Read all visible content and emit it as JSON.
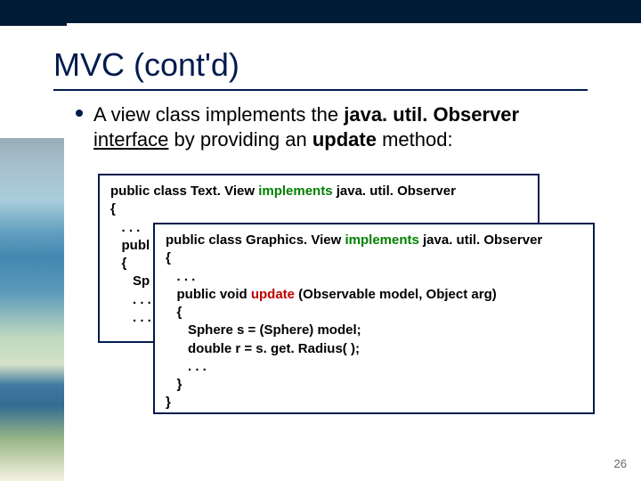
{
  "title": "MVC (cont'd)",
  "body": {
    "pre": "A view class implements the ",
    "kw1": "java. util. Observer",
    "mid_ul": "interface",
    "mid": " by providing an ",
    "kw2": "update",
    "post": " method:"
  },
  "codeA": {
    "l1a": "public class Text. View ",
    "l1b": "implements",
    "l1c": " java. util. Observer",
    "l2": "{",
    "l3": "   . . .",
    "l4": "   publ",
    "l5": "   {",
    "l6": "      Sp",
    "l7": "      . . .",
    "l8": "      . . ."
  },
  "codeB": {
    "l1a": "public class Graphics. View ",
    "l1b": "implements",
    "l1c": " java. util. Observer",
    "l2": "{",
    "l3": "   . . .",
    "l4a": "   public void ",
    "l4b": "update",
    "l4c": " (Observable model, Object arg)",
    "l5": "   {",
    "l6": "      Sphere s = (Sphere) model;",
    "l7": "      double r = s. get. Radius( );",
    "l8": "      . . .",
    "l9": "   }",
    "l10": "}"
  },
  "page": "26"
}
